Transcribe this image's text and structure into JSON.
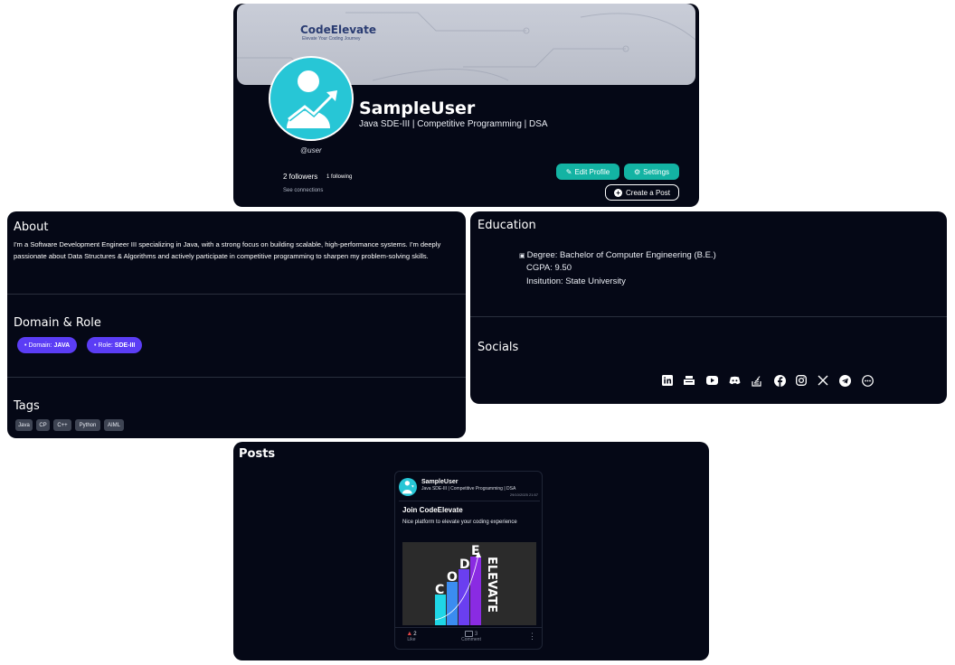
{
  "colors": {
    "card_bg": "#050816",
    "accent_teal": "#13b3a3",
    "pill_purple": "#5b3df5",
    "avatar_cyan": "#27c6d6"
  },
  "profile": {
    "banner": {
      "brand": "CodeElevate",
      "tagline": "Elevate Your Coding Journey"
    },
    "name": "SampleUser",
    "headline": "Java SDE-III | Competitive Programming | DSA",
    "handle": "@user",
    "followers": "2 followers",
    "following": "1 following",
    "see_connections": "See connections",
    "edit_profile": "Edit Profile",
    "settings": "Settings",
    "create_post": "Create a Post"
  },
  "about": {
    "title": "About",
    "text": "I'm a Software Development Engineer III specializing in Java, with a strong focus on building scalable, high-performance systems. I'm deeply passionate about Data Structures & Algorithms and actively participate in competitive programming to sharpen my problem-solving skills."
  },
  "domain_role": {
    "title": "Domain & Role",
    "domain_label": "Domain:",
    "domain_value": "JAVA",
    "role_label": "Role:",
    "role_value": "SDE-III"
  },
  "tags": {
    "title": "Tags",
    "items": [
      "Java",
      "CP",
      "C++",
      "Python",
      "AIML"
    ]
  },
  "education": {
    "title": "Education",
    "degree": "Degree: Bachelor of Computer Engineering (B.E.)",
    "cgpa": "CGPA: 9.50",
    "institution": "Insitution: State University"
  },
  "socials": {
    "title": "Socials",
    "icons": [
      "linkedin-icon",
      "codechef-icon",
      "youtube-icon",
      "discord-icon",
      "stackoverflow-icon",
      "facebook-icon",
      "instagram-icon",
      "x-icon",
      "telegram-icon",
      "more-icon"
    ]
  },
  "posts": {
    "title": "Posts",
    "items": [
      {
        "author": "SampleUser",
        "headline": "Java SDE-III | Competitive Programming | DSA",
        "date": "29/10/2025 21:57",
        "title": "Join CodeElevate",
        "body": "Nice platform to elevate your coding experience",
        "image_letters": "CODE ELEVATE",
        "likes": "2",
        "like_label": "Like",
        "comments": "3",
        "comment_label": "Comment"
      }
    ]
  }
}
